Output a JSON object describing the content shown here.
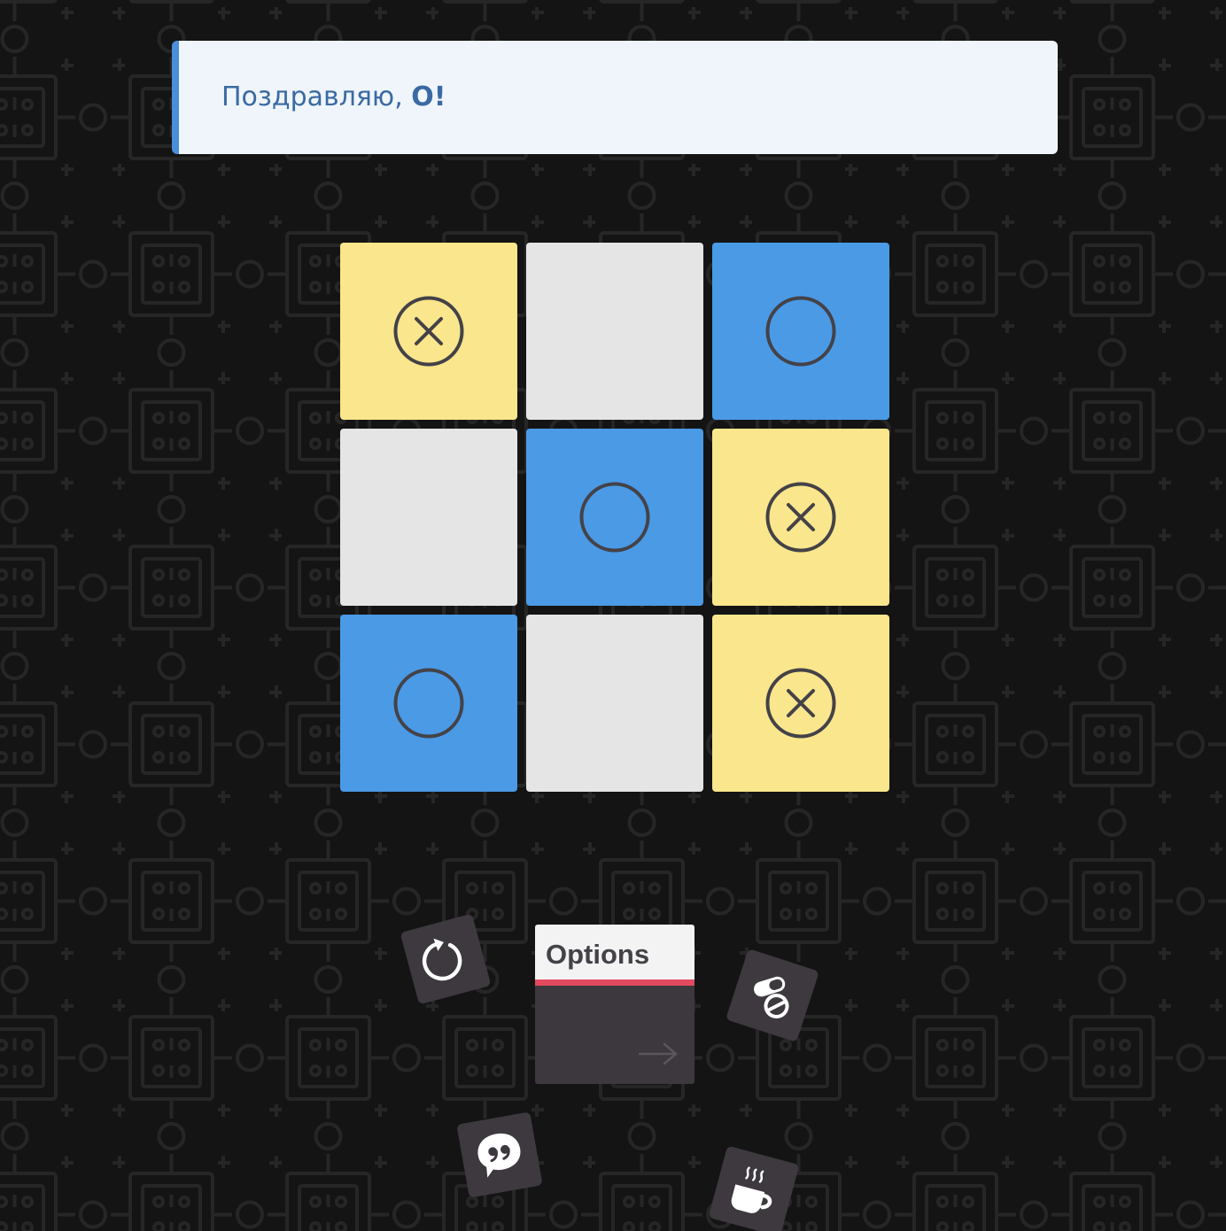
{
  "notice": {
    "text": "Поздравляю, ",
    "winner": "O!"
  },
  "board": {
    "cells": [
      {
        "mark": "X",
        "color": "#fae68c"
      },
      {
        "mark": "",
        "color": "#e5e5e5"
      },
      {
        "mark": "O",
        "color": "#4a9ae6"
      },
      {
        "mark": "",
        "color": "#e5e5e5"
      },
      {
        "mark": "O",
        "color": "#4a9ae6"
      },
      {
        "mark": "X",
        "color": "#fae68c"
      },
      {
        "mark": "O",
        "color": "#4a9ae6"
      },
      {
        "mark": "",
        "color": "#e5e5e5"
      },
      {
        "mark": "X",
        "color": "#fae68c"
      }
    ]
  },
  "options": {
    "label": "Options",
    "stripe_color": "#e34a60"
  },
  "tiles": [
    {
      "name": "restart-icon"
    },
    {
      "name": "pills-icon"
    },
    {
      "name": "quote-bubble-icon"
    },
    {
      "name": "coffee-cup-icon"
    }
  ],
  "colors": {
    "background": "#141414",
    "notice_bg": "#eff5fa",
    "notice_accent": "#4a8fd9",
    "notice_text": "#3a6aa3",
    "tile_bg": "#3d393f"
  }
}
